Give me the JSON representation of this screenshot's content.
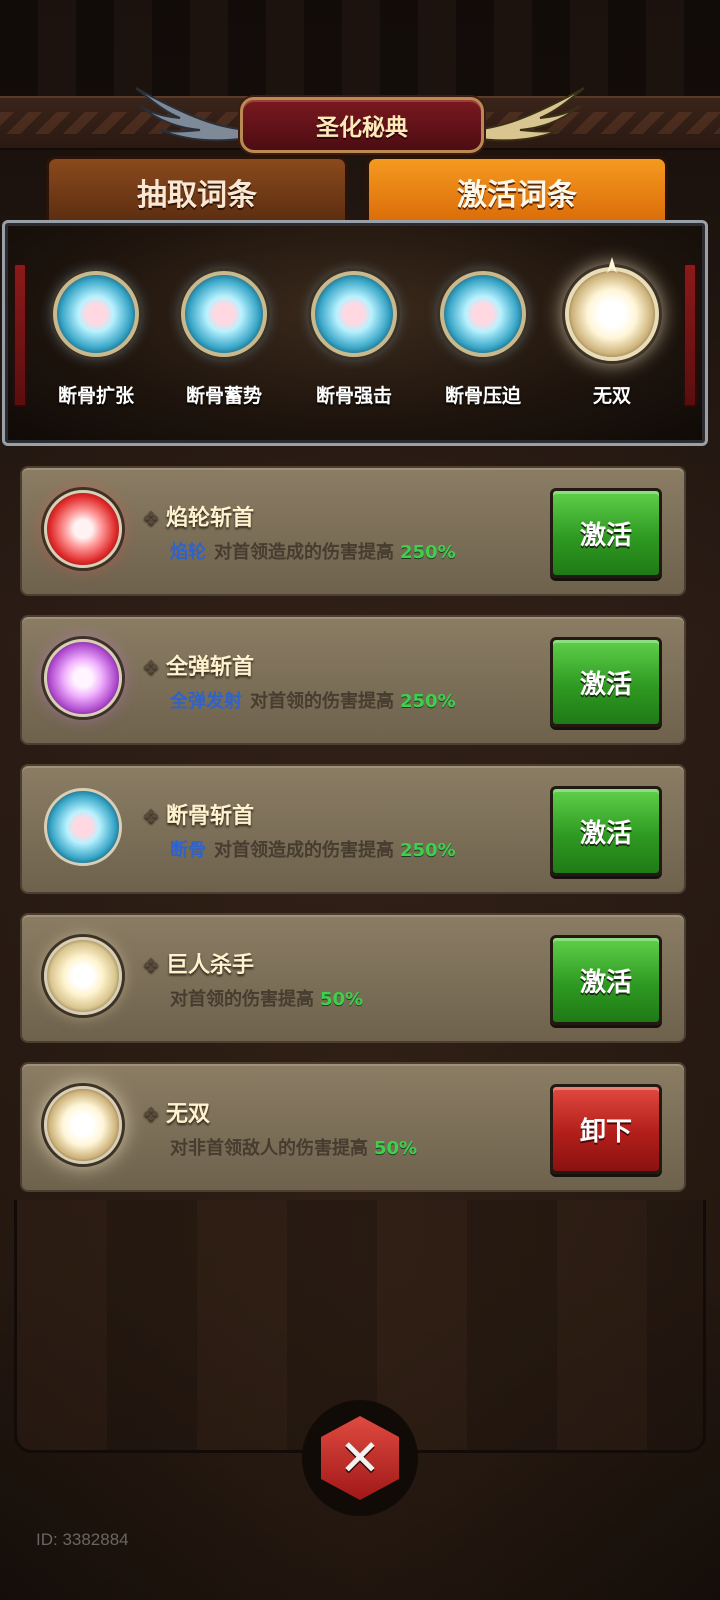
{
  "header": {
    "title": "圣化秘典"
  },
  "tabs": [
    {
      "label": "抽取词条",
      "active": false
    },
    {
      "label": "激活词条",
      "active": true
    }
  ],
  "equipped_slots": [
    {
      "label": "断骨扩张",
      "orb": "bone-orb-icon"
    },
    {
      "label": "断骨蓄势",
      "orb": "bone-orb-icon"
    },
    {
      "label": "断骨强击",
      "orb": "bone-orb-icon"
    },
    {
      "label": "断骨压迫",
      "orb": "bone-orb-icon"
    },
    {
      "label": "无双",
      "orb": "unique-orb-icon"
    }
  ],
  "cards": [
    {
      "title": "焰轮斩首",
      "tag": "焰轮",
      "desc": "对首领造成的伤害提高",
      "value": "250%",
      "button": "激活",
      "button_type": "activate",
      "orb": "red-orb-icon"
    },
    {
      "title": "全弹斩首",
      "tag": "全弹发射",
      "desc": "对首领的伤害提高",
      "value": "250%",
      "button": "激活",
      "button_type": "activate",
      "orb": "purple-orb-icon"
    },
    {
      "title": "断骨斩首",
      "tag": "断骨",
      "desc": "对首领造成的伤害提高",
      "value": "250%",
      "button": "激活",
      "button_type": "activate",
      "orb": "bone-orb-icon"
    },
    {
      "title": "巨人杀手",
      "tag": "",
      "desc": "对首领的伤害提高",
      "value": "50%",
      "button": "激活",
      "button_type": "activate",
      "orb": "gold-orb-icon"
    },
    {
      "title": "无双",
      "tag": "",
      "desc": "对非首领敌人的伤害提高",
      "value": "50%",
      "button": "卸下",
      "button_type": "unequip",
      "orb": "unique-orb-icon"
    }
  ],
  "colors": {
    "tag_blue": "#2f63c9",
    "value_green": "#3ed04d",
    "activate_green": "#2f9a22",
    "unequip_red": "#b21e1a",
    "tab_active_orange": "#f59a20"
  },
  "footer": {
    "id_text": "ID: 3382884",
    "close_icon": "close-x-icon"
  }
}
